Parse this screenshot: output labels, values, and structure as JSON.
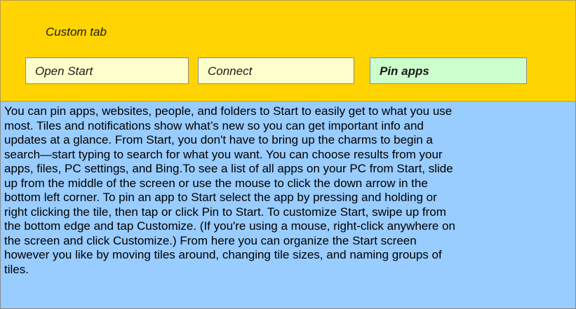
{
  "header": {
    "title": "Custom tab",
    "tabs": [
      {
        "label": "Open Start"
      },
      {
        "label": "Connect"
      },
      {
        "label": "Pin apps"
      }
    ]
  },
  "content": {
    "lines": [
      "You can pin apps, websites, people, and folders to Start to easily get to what you use",
      "most. Tiles and notifications show what’s new so you can get important info and",
      "updates at a glance. From Start, you don't have to bring up the charms to begin a",
      "search—start typing to search for what you want. You can choose results from your",
      "apps, files, PC settings, and Bing.To see a list of all apps on your PC from Start, slide",
      "up from the middle of the screen or use the mouse to click the down arrow in the",
      "bottom left corner. To pin an app to Start select the app by pressing and holding or",
      "right clicking the tile, then tap or click Pin to Start. To customize Start, swipe up from",
      "the bottom edge and tap Customize. (If you're using a mouse, right-click anywhere on",
      "the screen and click Customize.) From here you can organize the Start screen",
      "however you like by moving tiles around, changing tile sizes, and naming groups of",
      "tiles."
    ]
  },
  "colors": {
    "header_bg": "#FFD400",
    "tab_bg": "#FFFFCC",
    "tab_active_bg": "#CCFFCC",
    "content_bg": "#99CCFF"
  }
}
